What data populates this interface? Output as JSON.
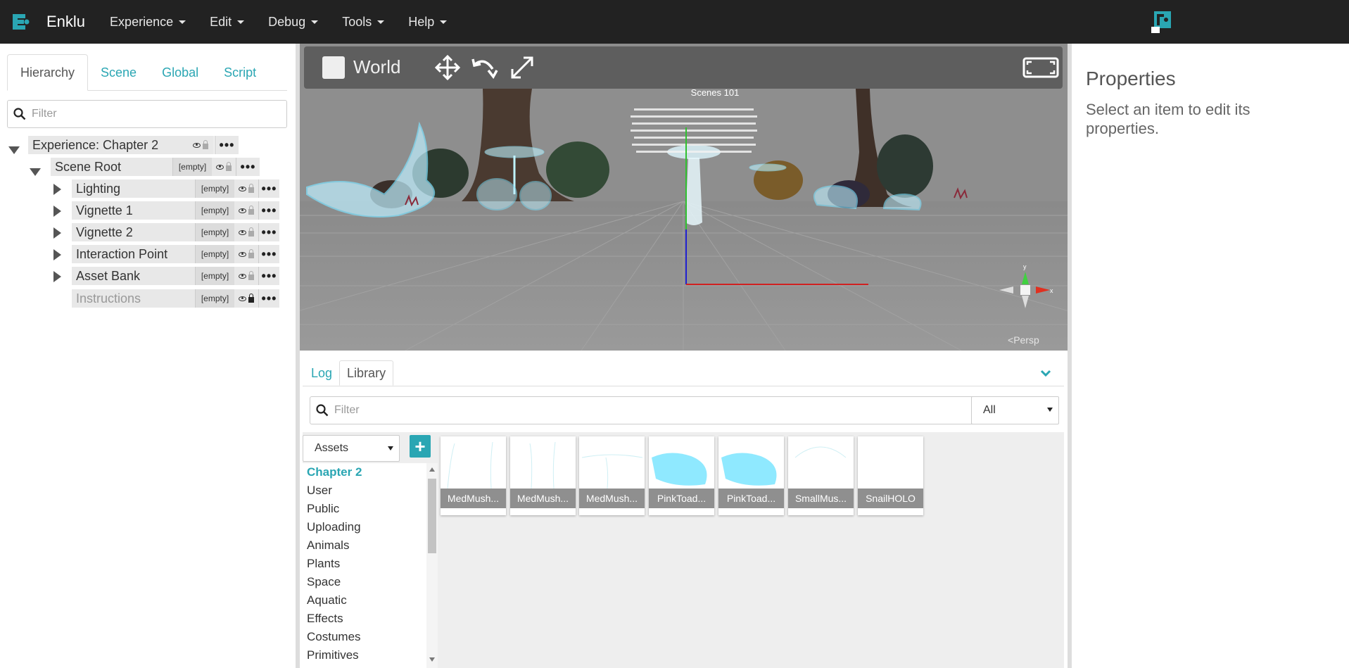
{
  "app": {
    "brand": "Enklu",
    "menu": [
      {
        "label": "Experience"
      },
      {
        "label": "Edit"
      },
      {
        "label": "Debug"
      },
      {
        "label": "Tools"
      },
      {
        "label": "Help"
      }
    ],
    "accent_color": "#2aa6b3"
  },
  "left_panel": {
    "tabs": [
      "Hierarchy",
      "Scene",
      "Global",
      "Script"
    ],
    "active_tab": "Hierarchy",
    "filter_placeholder": "Filter",
    "tree": {
      "experience": "Experience: Chapter 2",
      "scene_root": "Scene Root",
      "empty_tag": "[empty]",
      "children": [
        {
          "label": "Lighting",
          "tag": "[empty]"
        },
        {
          "label": "Vignette 1",
          "tag": "[empty]"
        },
        {
          "label": "Vignette 2",
          "tag": "[empty]"
        },
        {
          "label": "Interaction Point",
          "tag": "[empty]"
        },
        {
          "label": "Asset Bank",
          "tag": "[empty]"
        },
        {
          "label": "Instructions",
          "tag": "[empty]"
        }
      ]
    }
  },
  "viewport": {
    "space_label": "World",
    "scene_title": "Scenes 101",
    "camera_mode": "Persp"
  },
  "library": {
    "tabs": [
      "Log",
      "Library"
    ],
    "active_tab": "Library",
    "filter_placeholder": "Filter",
    "type_filter": "All",
    "source_select": "Assets",
    "add_label": "+",
    "folders": [
      "Chapter 2",
      "User",
      "Public",
      "Uploading",
      "Animals",
      "Plants",
      "Space",
      "Aquatic",
      "Effects",
      "Costumes",
      "Primitives"
    ],
    "active_folder": "Chapter 2",
    "assets": [
      {
        "name": "MedMush..."
      },
      {
        "name": "MedMush..."
      },
      {
        "name": "MedMush..."
      },
      {
        "name": "PinkToad..."
      },
      {
        "name": "PinkToad..."
      },
      {
        "name": "SmallMus..."
      },
      {
        "name": "SnailHOLO"
      }
    ]
  },
  "properties": {
    "title": "Properties",
    "hint": "Select an item to edit its properties."
  }
}
